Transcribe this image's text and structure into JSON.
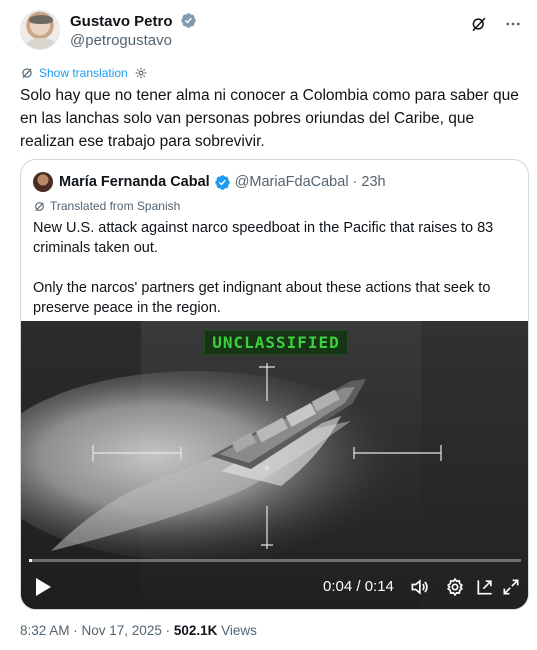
{
  "author": {
    "name": "Gustavo Petro",
    "handle": "@petrogustavo",
    "avatar_icon": "profile-photo",
    "verified_color": "#1d9bf0"
  },
  "header_actions": [
    "grok-icon",
    "more-icon"
  ],
  "translation": {
    "label": "Show translation",
    "link_color": "#1d9bf0"
  },
  "tweet": {
    "lines": [
      "Solo hay que no tener alma ni conocer a Colombia como para saber que",
      "en las lanchas solo van personas pobres oriundas del Caribe, que",
      "realizan ese trabajo para sobrevivir."
    ]
  },
  "quoted": {
    "name": "María Fernanda Cabal",
    "handle": "@MariaFdaCabal",
    "time": "· 23h",
    "translated_label": "Translated from Spanish",
    "paragraphs": [
      "New U.S. attack against narco speedboat in the Pacific that raises to 83 criminals taken out.",
      "Only the narcos' partners get indignant about these actions that seek to preserve peace in the region."
    ],
    "video": {
      "badge": "UNCLASSIFIED",
      "badge_color": "#3cd13c",
      "time_display": "0:04 / 0:14",
      "progress_fraction": 0.006,
      "controls": [
        "play-icon",
        "volume-icon",
        "settings-icon",
        "pip-icon",
        "fullscreen-icon"
      ]
    }
  },
  "meta": {
    "timestamp": "8:32 AM · Nov 17, 2025 · ",
    "views_count": "502.1K",
    "views_label": " Views"
  }
}
